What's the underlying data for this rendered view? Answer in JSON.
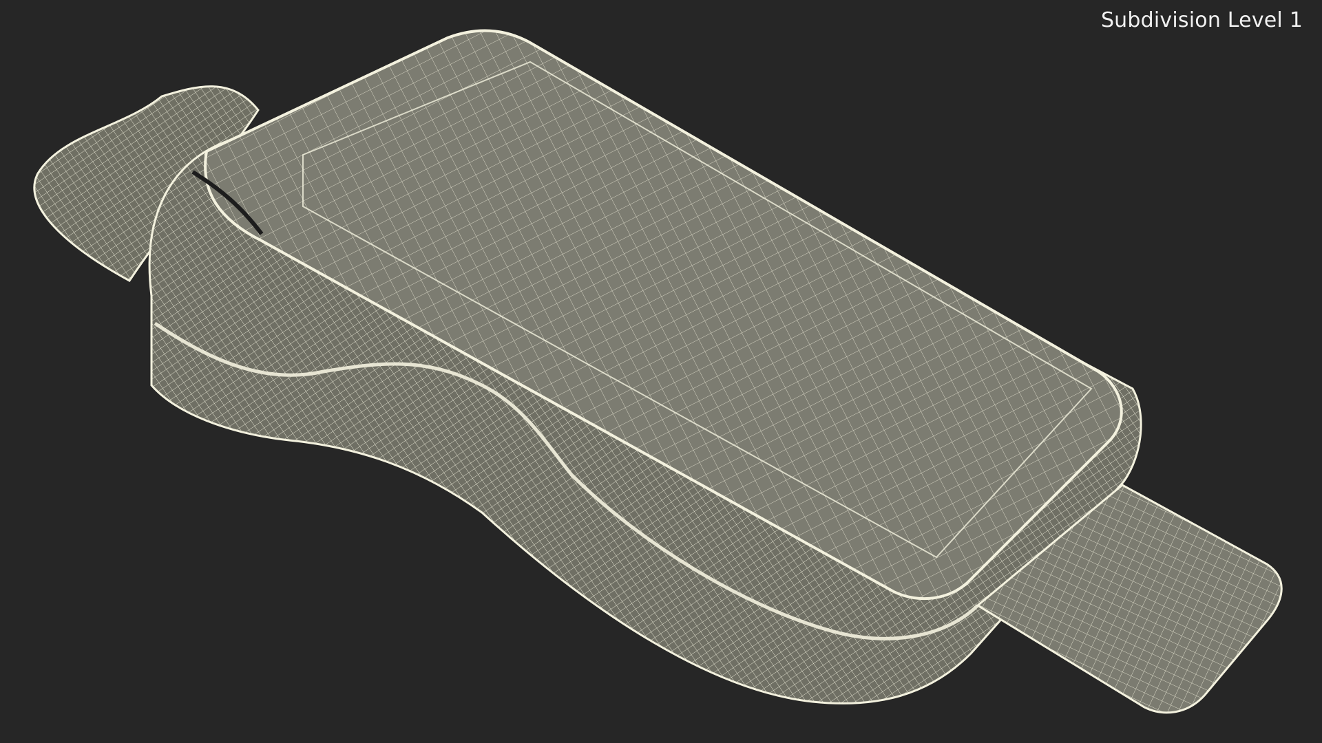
{
  "overlay": {
    "subdivision_label": "Subdivision Level 1"
  },
  "scene": {
    "object": "wireframe-handheld-payment-terminal",
    "background_color": "#262626",
    "surface_color": "#7a7a6e",
    "wire_color": "#f3f1de"
  }
}
